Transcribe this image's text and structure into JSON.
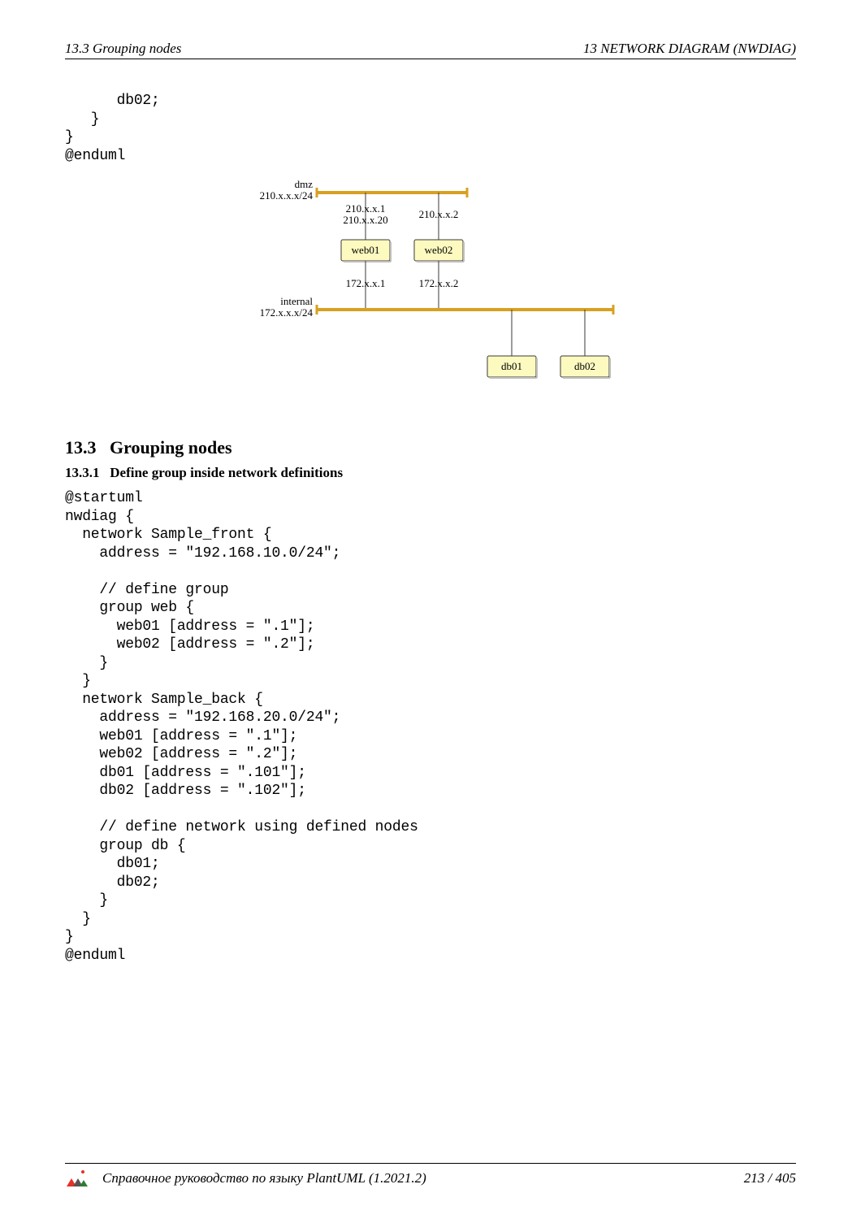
{
  "header": {
    "left": "13.3   Grouping nodes",
    "right": "13   NETWORK DIAGRAM (NWDIAG)"
  },
  "code_top": "      db02;\n   }\n}\n@enduml",
  "section": {
    "num": "13.3",
    "title": "Grouping nodes",
    "sub_num": "13.3.1",
    "sub_title": "Define group inside network definitions"
  },
  "code_main": "@startuml\nnwdiag {\n  network Sample_front {\n    address = \"192.168.10.0/24\";\n\n    // define group\n    group web {\n      web01 [address = \".1\"];\n      web02 [address = \".2\"];\n    }\n  }\n  network Sample_back {\n    address = \"192.168.20.0/24\";\n    web01 [address = \".1\"];\n    web02 [address = \".2\"];\n    db01 [address = \".101\"];\n    db02 [address = \".102\"];\n\n    // define network using defined nodes\n    group db {\n      db01;\n      db02;\n    }\n  }\n}\n@enduml",
  "diagram": {
    "net1": {
      "label": "dmz",
      "cidr": "210.x.x.x/24"
    },
    "net2": {
      "label": "internal",
      "cidr": "172.x.x.x/24"
    },
    "web01": {
      "name": "web01",
      "addr1a": "210.x.x.1",
      "addr1b": "210.x.x.20",
      "addr2": "172.x.x.1"
    },
    "web02": {
      "name": "web02",
      "addr1": "210.x.x.2",
      "addr2": "172.x.x.2"
    },
    "db01": {
      "name": "db01"
    },
    "db02": {
      "name": "db02"
    }
  },
  "footer": {
    "text": "Справочное руководство по языку PlantUML (1.2021.2)",
    "page": "213 / 405"
  }
}
